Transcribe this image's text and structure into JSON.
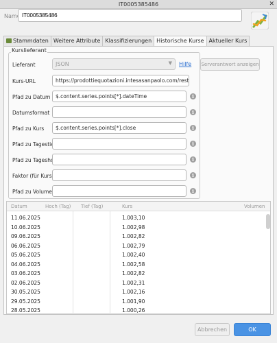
{
  "window": {
    "title": "IT0005385486",
    "close_glyph": "✕"
  },
  "name": {
    "label": "Name",
    "value": "IT0005385486"
  },
  "tabs": [
    {
      "label": "Stammdaten",
      "active": false
    },
    {
      "label": "Weitere Attribute",
      "active": false
    },
    {
      "label": "Klassifizierungen",
      "active": false
    },
    {
      "label": "Historische Kurse",
      "active": true
    },
    {
      "label": "Aktueller Kurs",
      "active": false
    }
  ],
  "form": {
    "group_title": "Kurslieferant",
    "provider_label": "Lieferant",
    "provider_value": "JSON",
    "help_link": "Hilfe",
    "server_button": "Serverantwort anzeigen",
    "url_label": "Kurs-URL",
    "url_value": "https://prodottiequotazioni.intesasanpaolo.com/rest/public",
    "date_path_label": "Pfad zu Datum",
    "date_path_value": "$.content.series.points[*].dateTime",
    "date_format_label": "Datumsformat",
    "date_format_value": "",
    "close_path_label": "Pfad zu Kurs",
    "close_path_value": "$.content.series.points[*].close",
    "low_path_label": "Pfad zu Tagestief",
    "low_path_value": "",
    "high_path_label": "Pfad zu Tageshoch",
    "high_path_value": "",
    "factor_label": "Faktor (für Kurse)",
    "factor_value": "",
    "volume_path_label": "Pfad zu Volumen",
    "volume_path_value": "",
    "info_glyph": "i"
  },
  "table": {
    "headers": [
      "Datum",
      "Hoch (Tag)",
      "Tief (Tag)",
      "Kurs",
      "Volumen"
    ],
    "rows": [
      [
        "11.06.2025",
        "1.003,10"
      ],
      [
        "10.06.2025",
        "1.002,98"
      ],
      [
        "09.06.2025",
        "1.002,82"
      ],
      [
        "06.06.2025",
        "1.002,79"
      ],
      [
        "05.06.2025",
        "1.002,40"
      ],
      [
        "04.06.2025",
        "1.002,58"
      ],
      [
        "03.06.2025",
        "1.002,82"
      ],
      [
        "02.06.2025",
        "1.002,31"
      ],
      [
        "30.05.2025",
        "1.002,16"
      ],
      [
        "29.05.2025",
        "1.001,90"
      ],
      [
        "28.05.2025",
        "1.000,26"
      ]
    ]
  },
  "buttons": {
    "cancel": "Abbrechen",
    "ok": "OK"
  },
  "colors": {
    "accent": "#4a93e4",
    "link": "#2a6fd1"
  }
}
